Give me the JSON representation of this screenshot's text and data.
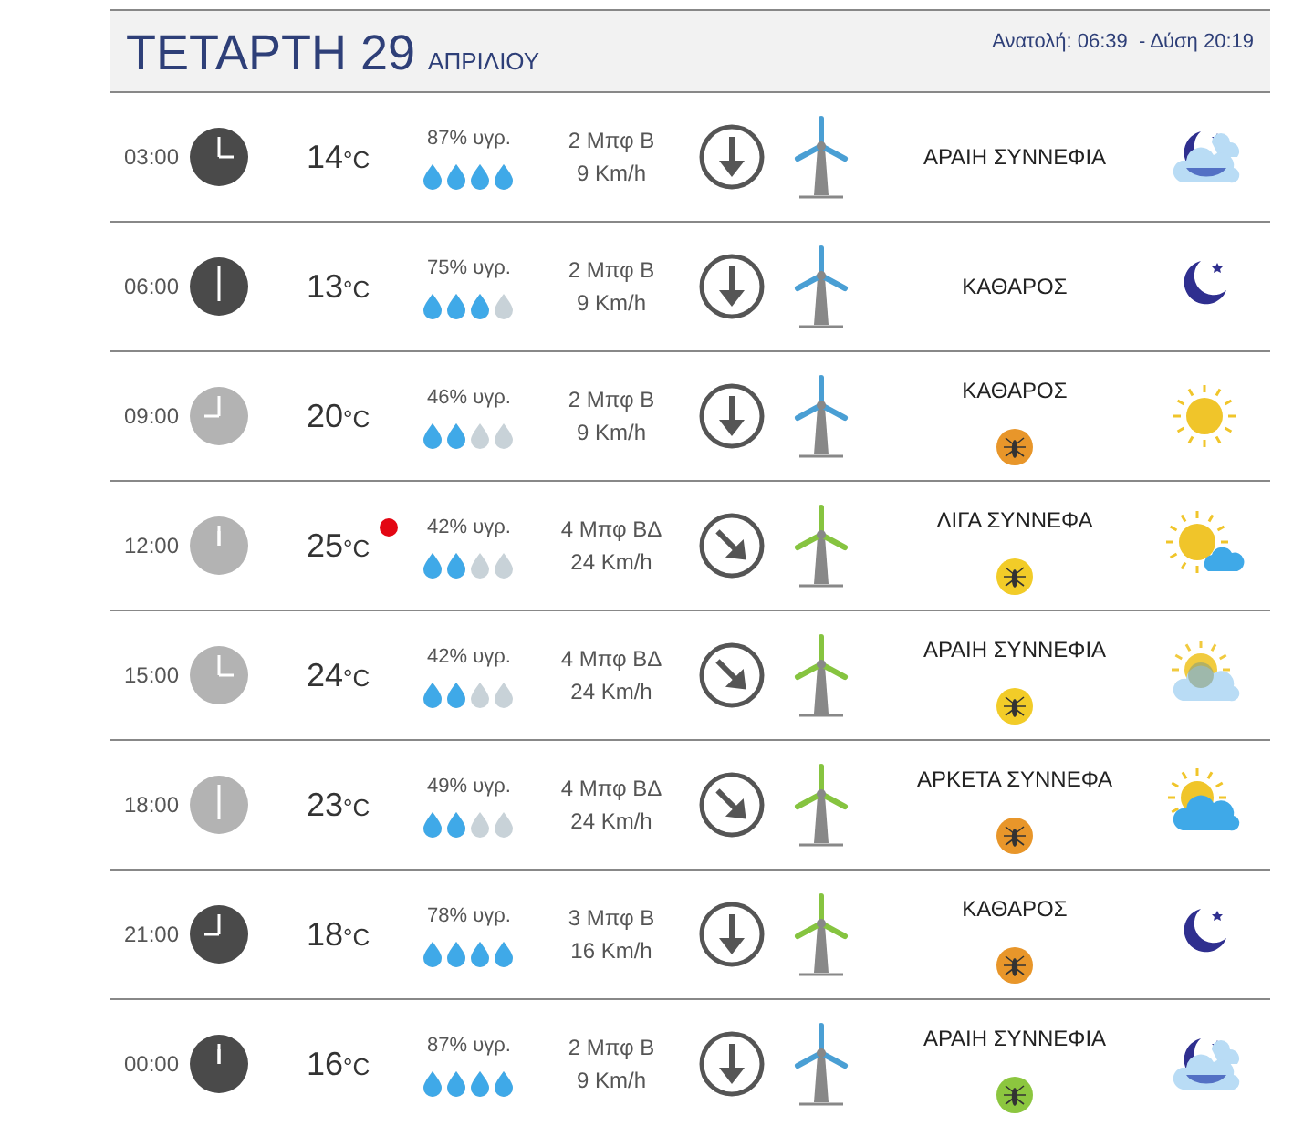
{
  "header": {
    "day": "ΤΕΤΑΡΤΗ 29",
    "month": "ΑΠΡΙΛΙΟΥ",
    "sun": "Ανατολή: 06:39  - Δύση 20:19"
  },
  "rows": [
    {
      "time": "03:00",
      "night": true,
      "temp": "14",
      "unit": "°C",
      "alert": false,
      "humidity": "87% υγρ.",
      "level": 1,
      "wind": "2 Μπφ Β",
      "speed": "9 Km/h",
      "wind_arrow": {
        "kind": "down"
      },
      "turbine": {
        "color": "#4a9fd4"
      },
      "condition": "ΑΡΑΙΗ ΣΥΝΝΕΦΙΑ",
      "weather_icon": {
        "kind": "night-few-clouds"
      }
    },
    {
      "time": "06:00",
      "night": true,
      "temp": "13",
      "unit": "°C",
      "alert": false,
      "humidity": "75% υγρ.",
      "level": 0.75,
      "wind": "2 Μπφ Β",
      "speed": "9 Km/h",
      "wind_arrow": {
        "kind": "down"
      },
      "turbine": {
        "color": "#4a9fd4"
      },
      "condition": "ΚΑΘΑΡΟΣ",
      "weather_icon": {
        "kind": "clear-night"
      }
    },
    {
      "time": "09:00",
      "night": false,
      "temp": "20",
      "unit": "°C",
      "alert": false,
      "humidity": "46% υγρ.",
      "level": 0.5,
      "wind": "2 Μπφ Β",
      "speed": "9 Km/h",
      "wind_arrow": {
        "kind": "down"
      },
      "turbine": {
        "color": "#4a9fd4"
      },
      "condition": "ΚΑΘΑΡΟΣ",
      "badge": {
        "color": "#e8962a"
      },
      "weather_icon": {
        "kind": "clear-day"
      }
    },
    {
      "time": "12:00",
      "night": false,
      "temp": "25",
      "unit": "°C",
      "alert": true,
      "humidity": "42% υγρ.",
      "level": 0.5,
      "wind": "4 Μπφ ΒΔ",
      "speed": "24 Km/h",
      "wind_arrow": {
        "kind": "down-right"
      },
      "turbine": {
        "color": "#86c440"
      },
      "condition": "ΛΙΓΑ ΣΥΝΝΕΦΑ",
      "badge": {
        "color": "#f2cc28"
      },
      "weather_icon": {
        "kind": "few-clouds"
      }
    },
    {
      "time": "15:00",
      "night": false,
      "temp": "24",
      "unit": "°C",
      "alert": false,
      "humidity": "42% υγρ.",
      "level": 0.5,
      "wind": "4 Μπφ ΒΔ",
      "speed": "24 Km/h",
      "wind_arrow": {
        "kind": "down-right"
      },
      "turbine": {
        "color": "#86c440"
      },
      "condition": "ΑΡΑΙΗ ΣΥΝΝΕΦΙΑ",
      "badge": {
        "color": "#f2cc28"
      },
      "weather_icon": {
        "kind": "scattered-clouds"
      }
    },
    {
      "time": "18:00",
      "night": false,
      "temp": "23",
      "unit": "°C",
      "alert": false,
      "humidity": "49% υγρ.",
      "level": 0.5,
      "wind": "4 Μπφ ΒΔ",
      "speed": "24 Km/h",
      "wind_arrow": {
        "kind": "down-right"
      },
      "turbine": {
        "color": "#86c440"
      },
      "condition": "ΑΡΚΕΤΑ ΣΥΝΝΕΦΑ",
      "badge": {
        "color": "#e8962a"
      },
      "weather_icon": {
        "kind": "broken-clouds"
      }
    },
    {
      "time": "21:00",
      "night": true,
      "temp": "18",
      "unit": "°C",
      "alert": false,
      "humidity": "78% υγρ.",
      "level": 1,
      "wind": "3 Μπφ Β",
      "speed": "16 Km/h",
      "wind_arrow": {
        "kind": "down"
      },
      "turbine": {
        "color": "#86c440"
      },
      "condition": "ΚΑΘΑΡΟΣ",
      "badge": {
        "color": "#e8962a"
      },
      "weather_icon": {
        "kind": "clear-night"
      }
    },
    {
      "time": "00:00",
      "night": true,
      "temp": "16",
      "unit": "°C",
      "alert": false,
      "humidity": "87% υγρ.",
      "level": 1,
      "wind": "2 Μπφ Β",
      "speed": "9 Km/h",
      "wind_arrow": {
        "kind": "down"
      },
      "turbine": {
        "color": "#4a9fd4"
      },
      "condition": "ΑΡΑΙΗ ΣΥΝΝΕΦΙΑ",
      "badge": {
        "color": "#8cc63f"
      },
      "weather_icon": {
        "kind": "night-few-clouds"
      }
    }
  ]
}
